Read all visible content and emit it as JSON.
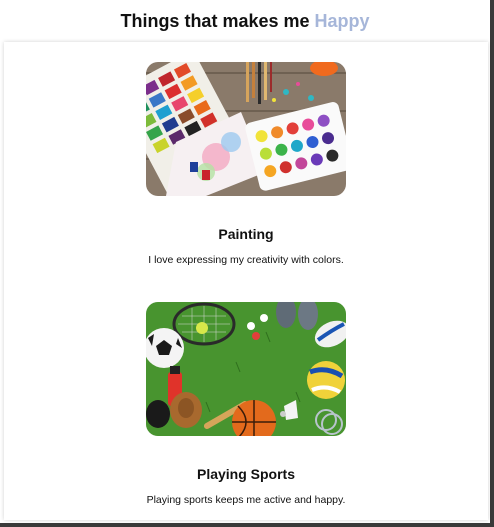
{
  "header": {
    "title_main": "Things that makes me ",
    "title_accent": "Happy"
  },
  "items": [
    {
      "title": "Painting",
      "description": "I love expressing my creativity with colors.",
      "image": "watercolor-paint-palettes-and-brushes"
    },
    {
      "title": "Playing Sports",
      "description": "Playing sports keeps me active and happy.",
      "image": "sports-balls-and-equipment-on-grass"
    }
  ],
  "colors": {
    "accent": "#a6b6d9",
    "text": "#111111",
    "frame_border": "#3a3a3a"
  }
}
